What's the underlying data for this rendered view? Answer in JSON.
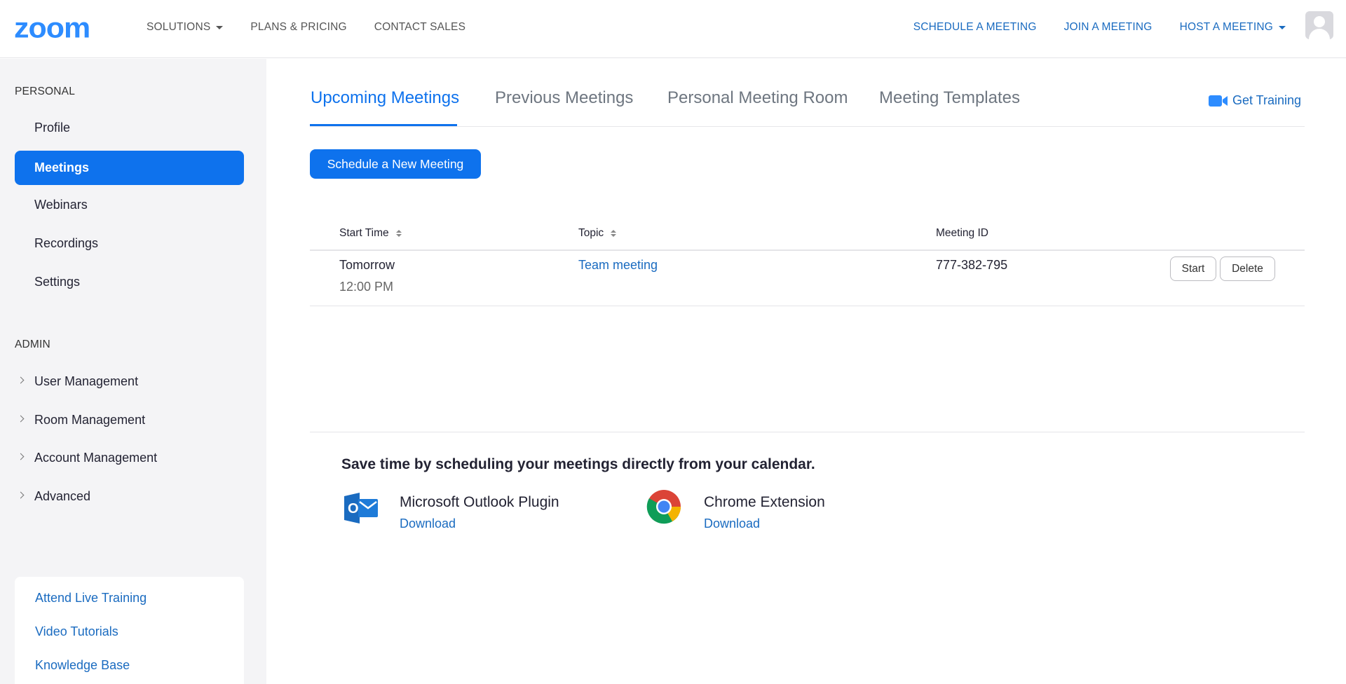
{
  "header": {
    "logo": "zoom",
    "nav_left": [
      {
        "label": "SOLUTIONS",
        "dropdown": true
      },
      {
        "label": "PLANS & PRICING",
        "dropdown": false
      },
      {
        "label": "CONTACT SALES",
        "dropdown": false
      }
    ],
    "nav_right": [
      {
        "label": "SCHEDULE A MEETING",
        "dropdown": false
      },
      {
        "label": "JOIN A MEETING",
        "dropdown": false
      },
      {
        "label": "HOST A MEETING",
        "dropdown": true
      }
    ],
    "avatar_icon": "user-avatar-icon"
  },
  "sidebar": {
    "personal_title": "PERSONAL",
    "personal_items": [
      {
        "label": "Profile",
        "active": false
      },
      {
        "label": "Meetings",
        "active": true
      },
      {
        "label": "Webinars",
        "active": false
      },
      {
        "label": "Recordings",
        "active": false
      },
      {
        "label": "Settings",
        "active": false
      }
    ],
    "admin_title": "ADMIN",
    "admin_items": [
      {
        "label": "User Management"
      },
      {
        "label": "Room Management"
      },
      {
        "label": "Account Management"
      },
      {
        "label": "Advanced"
      }
    ],
    "help_links": [
      "Attend Live Training",
      "Video Tutorials",
      "Knowledge Base"
    ]
  },
  "main": {
    "tabs": [
      {
        "label": "Upcoming Meetings",
        "active": true
      },
      {
        "label": "Previous Meetings",
        "active": false
      },
      {
        "label": "Personal Meeting Room",
        "active": false
      },
      {
        "label": "Meeting Templates",
        "active": false
      }
    ],
    "get_training": "Get Training",
    "schedule_button": "Schedule a New Meeting",
    "table": {
      "columns": [
        "Start Time",
        "Topic",
        "Meeting ID"
      ],
      "rows": [
        {
          "day": "Tomorrow",
          "time": "12:00 PM",
          "topic": "Team meeting",
          "meeting_id": "777-382-795",
          "actions": [
            "Start",
            "Delete"
          ]
        }
      ]
    },
    "calendar": {
      "title": "Save time by scheduling your meetings directly from your calendar.",
      "extensions": [
        {
          "name": "Microsoft Outlook Plugin",
          "link": "Download",
          "icon": "outlook-icon"
        },
        {
          "name": "Chrome Extension",
          "link": "Download",
          "icon": "chrome-icon"
        }
      ]
    }
  },
  "colors": {
    "accent": "#0e72ed",
    "link": "#1a6bc0",
    "sidebar_bg": "#f4f4f6"
  }
}
